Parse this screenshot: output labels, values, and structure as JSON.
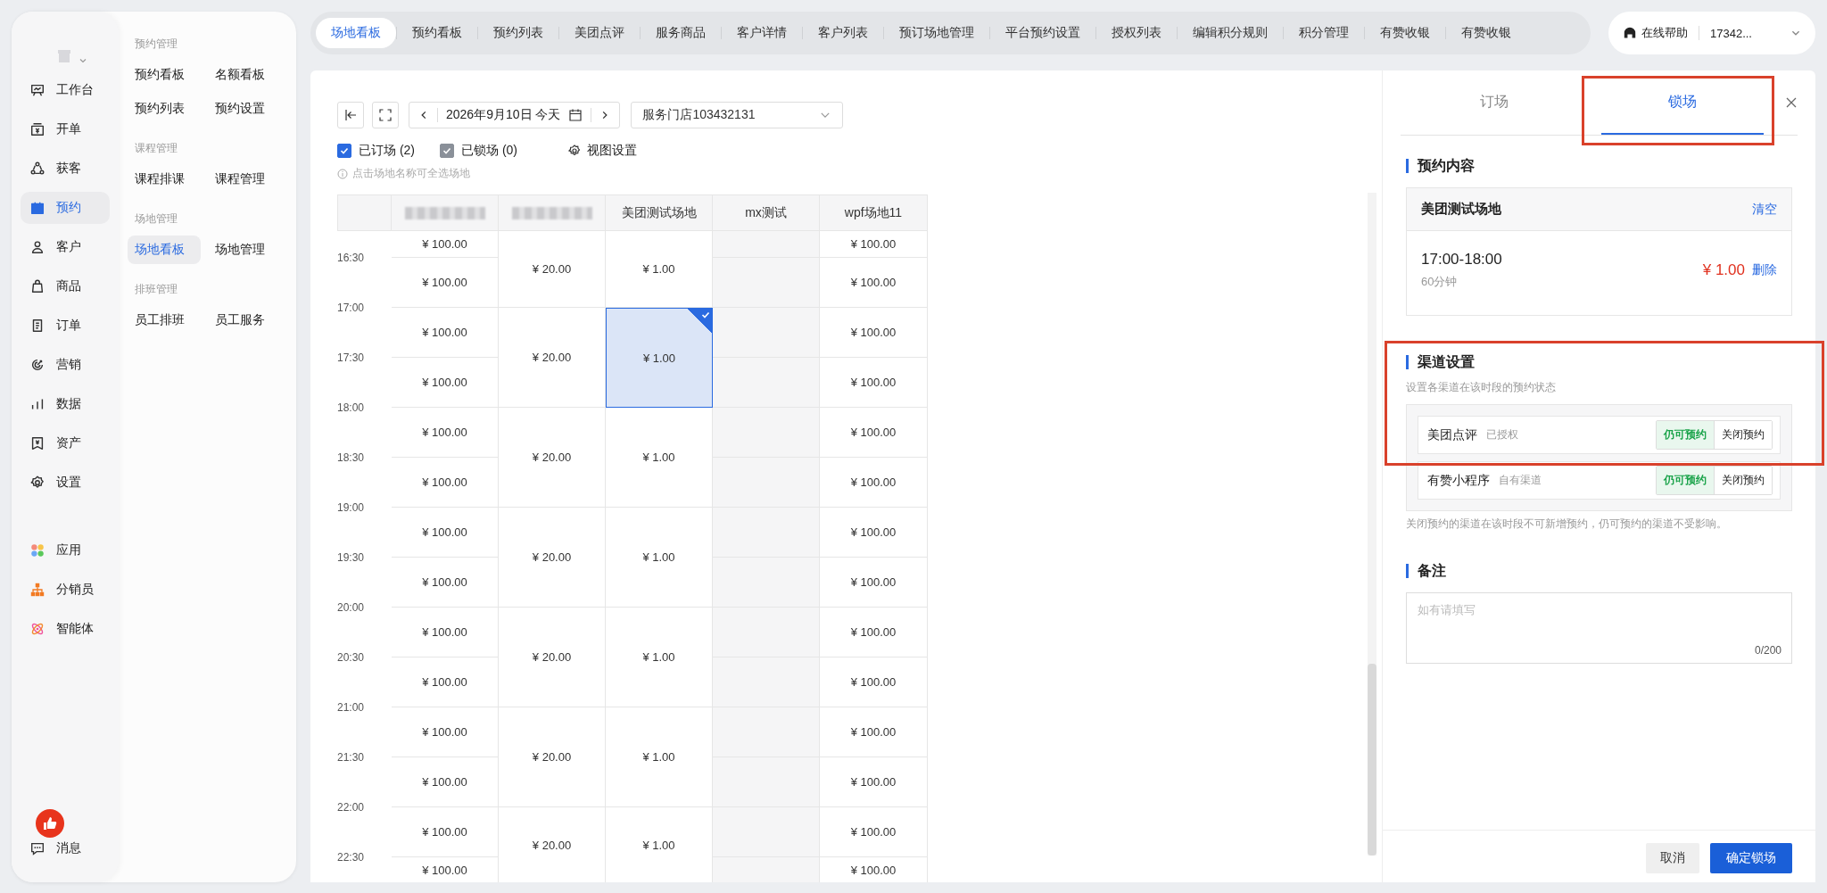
{
  "nav": {
    "items": [
      {
        "label": "工作台",
        "selected": false
      },
      {
        "label": "开单",
        "selected": false
      },
      {
        "label": "获客",
        "selected": false
      },
      {
        "label": "预约",
        "selected": true
      },
      {
        "label": "客户",
        "selected": false
      },
      {
        "label": "商品",
        "selected": false
      },
      {
        "label": "订单",
        "selected": false
      },
      {
        "label": "营销",
        "selected": false
      },
      {
        "label": "数据",
        "selected": false
      },
      {
        "label": "资产",
        "selected": false
      },
      {
        "label": "设置",
        "selected": false
      }
    ],
    "apps": [
      {
        "label": "应用",
        "selected": false
      },
      {
        "label": "分销员",
        "selected": false
      },
      {
        "label": "智能体",
        "selected": false
      }
    ],
    "messages": {
      "label": "消息"
    }
  },
  "submenu": [
    {
      "title": "预约管理",
      "items": [
        {
          "label": "预约看板",
          "selected": false
        },
        {
          "label": "名额看板",
          "selected": false
        },
        {
          "label": "预约列表",
          "selected": false
        },
        {
          "label": "预约设置",
          "selected": false
        }
      ]
    },
    {
      "title": "课程管理",
      "items": [
        {
          "label": "课程排课",
          "selected": false
        },
        {
          "label": "课程管理",
          "selected": false
        }
      ]
    },
    {
      "title": "场地管理",
      "items": [
        {
          "label": "场地看板",
          "selected": true
        },
        {
          "label": "场地管理",
          "selected": false
        }
      ]
    },
    {
      "title": "排班管理",
      "items": [
        {
          "label": "员工排班",
          "selected": false
        },
        {
          "label": "员工服务",
          "selected": false
        }
      ]
    }
  ],
  "tabs": [
    {
      "label": "场地看板",
      "selected": true
    },
    {
      "label": "预约看板",
      "selected": false
    },
    {
      "label": "预约列表",
      "selected": false
    },
    {
      "label": "美团点评",
      "selected": false
    },
    {
      "label": "服务商品",
      "selected": false
    },
    {
      "label": "客户详情",
      "selected": false
    },
    {
      "label": "客户列表",
      "selected": false
    },
    {
      "label": "预订场地管理",
      "selected": false
    },
    {
      "label": "平台预约设置",
      "selected": false
    },
    {
      "label": "授权列表",
      "selected": false
    },
    {
      "label": "编辑积分规则",
      "selected": false
    },
    {
      "label": "积分管理",
      "selected": false
    },
    {
      "label": "有赞收银",
      "selected": false
    },
    {
      "label": "有赞收银",
      "selected": false
    }
  ],
  "header": {
    "help": "在线帮助",
    "account": "17342..."
  },
  "toolbar": {
    "date": "2026年9月10日 今天",
    "store": "服务门店103432131",
    "filters": [
      {
        "label": "已订场 (2)",
        "checked": true
      },
      {
        "label": "已锁场 (0)",
        "checked": true
      }
    ],
    "view_settings": "视图设置",
    "hint": "点击场地名称可全选场地"
  },
  "schedule": {
    "time_labels": [
      "16:30",
      "17:00",
      "17:30",
      "18:00",
      "18:30",
      "19:00",
      "19:30",
      "20:00",
      "20:30",
      "21:00",
      "21:30",
      "22:00",
      "22:30"
    ],
    "columns": [
      {
        "kind": "half",
        "blurred": true,
        "cells": [
          {
            "price": "¥ 100.00",
            "selected": false
          },
          {
            "price": "¥ 100.00",
            "selected": false
          },
          {
            "price": "¥ 100.00",
            "selected": false
          },
          {
            "price": "¥ 100.00",
            "selected": false
          },
          {
            "price": "¥ 100.00",
            "selected": false
          },
          {
            "price": "¥ 100.00",
            "selected": false
          },
          {
            "price": "¥ 100.00",
            "selected": false
          },
          {
            "price": "¥ 100.00",
            "selected": false
          },
          {
            "price": "¥ 100.00",
            "selected": false
          },
          {
            "price": "¥ 100.00",
            "selected": false
          },
          {
            "price": "¥ 100.00",
            "selected": false
          },
          {
            "price": "¥ 100.00",
            "selected": false
          },
          {
            "price": "¥ 100.00",
            "selected": false
          },
          {
            "price": "¥ 100.00",
            "selected": false
          }
        ]
      },
      {
        "kind": "hour",
        "blurred": true,
        "cells": [
          {
            "price": "¥ 20.00",
            "selected": false
          },
          {
            "price": "¥ 20.00",
            "selected": false
          },
          {
            "price": "¥ 20.00",
            "selected": false
          },
          {
            "price": "¥ 20.00",
            "selected": false
          },
          {
            "price": "¥ 20.00",
            "selected": false
          },
          {
            "price": "¥ 20.00",
            "selected": false
          },
          {
            "price": "¥ 20.00",
            "selected": false
          }
        ]
      },
      {
        "kind": "hour",
        "blurred": false,
        "label": "美团测试场地",
        "cells": [
          {
            "price": "¥ 1.00",
            "selected": false
          },
          {
            "price": "¥ 1.00",
            "selected": true
          },
          {
            "price": "¥ 1.00",
            "selected": false
          },
          {
            "price": "¥ 1.00",
            "selected": false
          },
          {
            "price": "¥ 1.00",
            "selected": false
          },
          {
            "price": "¥ 1.00",
            "selected": false
          },
          {
            "price": "¥ 1.00",
            "selected": false
          }
        ]
      },
      {
        "kind": "closed",
        "blurred": false,
        "label": "mx测试"
      },
      {
        "kind": "half",
        "blurred": false,
        "label": "wpf场地11",
        "cells": [
          {
            "price": "¥ 100.00",
            "selected": false
          },
          {
            "price": "¥ 100.00",
            "selected": false
          },
          {
            "price": "¥ 100.00",
            "selected": false
          },
          {
            "price": "¥ 100.00",
            "selected": false
          },
          {
            "price": "¥ 100.00",
            "selected": false
          },
          {
            "price": "¥ 100.00",
            "selected": false
          },
          {
            "price": "¥ 100.00",
            "selected": false
          },
          {
            "price": "¥ 100.00",
            "selected": false
          },
          {
            "price": "¥ 100.00",
            "selected": false
          },
          {
            "price": "¥ 100.00",
            "selected": false
          },
          {
            "price": "¥ 100.00",
            "selected": false
          },
          {
            "price": "¥ 100.00",
            "selected": false
          },
          {
            "price": "¥ 100.00",
            "selected": false
          },
          {
            "price": "¥ 100.00",
            "selected": false
          }
        ]
      }
    ]
  },
  "panel": {
    "tabs": [
      {
        "label": "订场",
        "selected": false,
        "highlighted": false
      },
      {
        "label": "锁场",
        "selected": true,
        "highlighted": true
      }
    ],
    "booking": {
      "title": "预约内容",
      "venue": "美团测试场地",
      "clear": "清空",
      "time": "17:00-18:00",
      "duration": "60分钟",
      "price": "¥ 1.00",
      "delete": "删除"
    },
    "channels": {
      "title": "渠道设置",
      "highlighted": true,
      "hint": "设置各渠道在该时段的预约状态",
      "items": [
        {
          "name": "美团点评",
          "note": "已授权",
          "options": [
            {
              "label": "仍可预约",
              "selected": true
            },
            {
              "label": "关闭预约",
              "selected": false
            }
          ]
        },
        {
          "name": "有赞小程序",
          "note": "自有渠道",
          "options": [
            {
              "label": "仍可预约",
              "selected": true
            },
            {
              "label": "关闭预约",
              "selected": false
            }
          ]
        }
      ],
      "footnote": "关闭预约的渠道在该时段不可新增预约，仍可预约的渠道不受影响。"
    },
    "remark": {
      "title": "备注",
      "placeholder": "如有请填写",
      "counter": "0/200"
    },
    "buttons": [
      {
        "label": "取消",
        "kind": "secondary"
      },
      {
        "label": "确定锁场",
        "kind": "primary"
      }
    ]
  }
}
